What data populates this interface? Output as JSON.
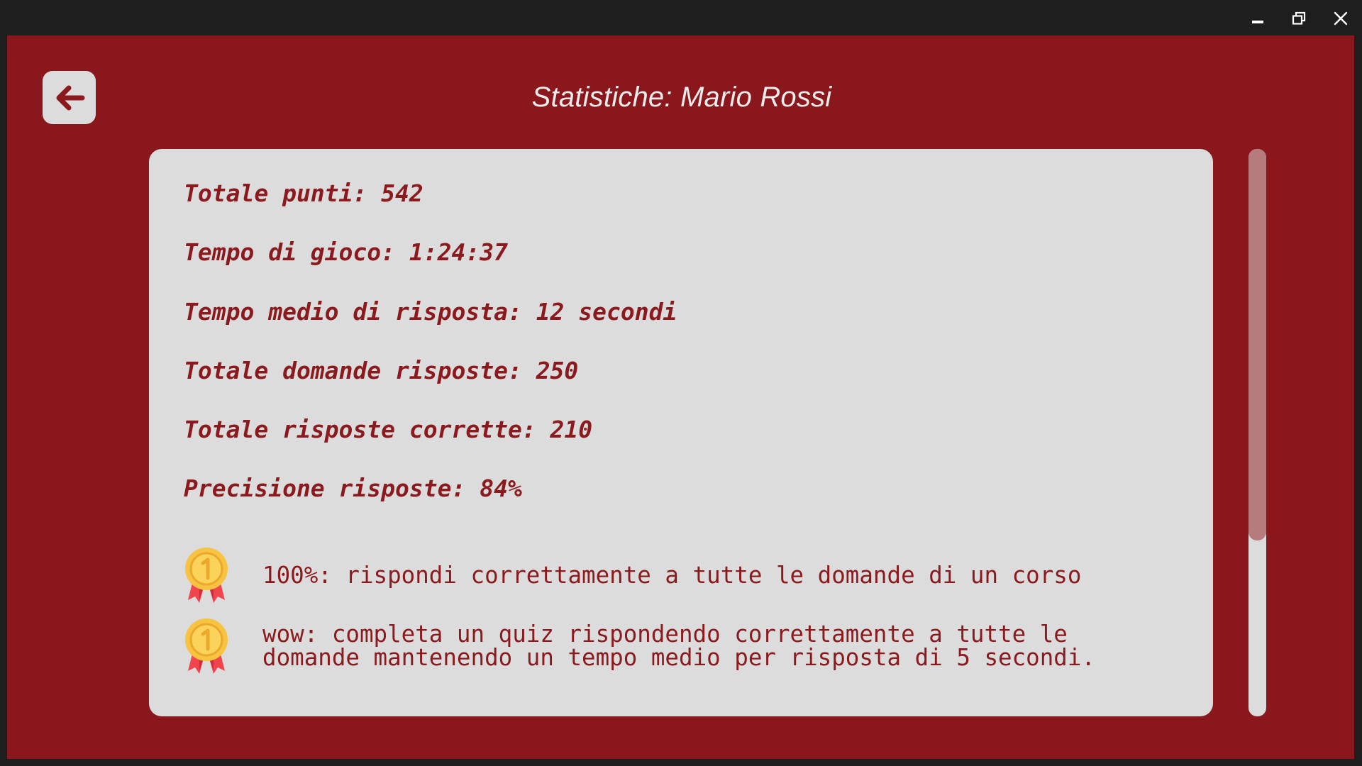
{
  "window": {
    "controls": [
      "minimize",
      "restore",
      "close"
    ]
  },
  "header": {
    "title": "Statistiche: Mario Rossi",
    "back_icon": "arrow-left-icon"
  },
  "stats": [
    {
      "label": "Totale punti: 542"
    },
    {
      "label": "Tempo di gioco: 1:24:37"
    },
    {
      "label": "Tempo medio di risposta: 12 secondi"
    },
    {
      "label": "Totale domande risposte: 250"
    },
    {
      "label": "Totale risposte corrette: 210"
    },
    {
      "label": "Precisione risposte: 84%"
    }
  ],
  "achievements": [
    {
      "icon": "medal-icon",
      "lines": [
        "100%: rispondi correttamente a tutte le domande di un corso"
      ]
    },
    {
      "icon": "medal-icon",
      "lines": [
        "wow: completa un quiz rispondendo correttamente a tutte le",
        "domande mantenendo un tempo medio per risposta di 5 secondi."
      ]
    }
  ],
  "colors": {
    "background": "#89171b",
    "panel": "#dcdcdc",
    "text": "#8a1a1e",
    "title": "#ececec",
    "scroll_thumb": "#b67b7d"
  },
  "scrollbar": {
    "visible_fraction": 0.69,
    "position": 0
  }
}
